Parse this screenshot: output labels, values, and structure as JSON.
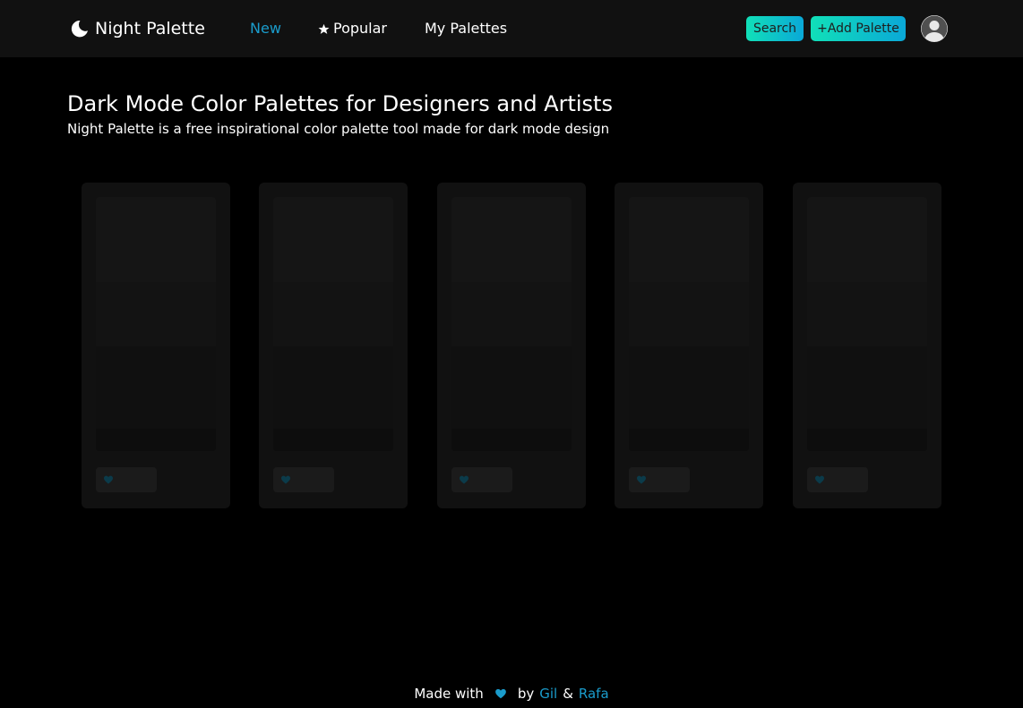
{
  "brand": {
    "name": "Night Palette",
    "icon": "moon-icon"
  },
  "nav": {
    "new": "New",
    "popular": "Popular",
    "my_palettes": "My Palettes"
  },
  "actions": {
    "search": "Search",
    "add_palette": "+Add Palette"
  },
  "hero": {
    "title": "Dark Mode Color Palettes for Designers and Artists",
    "subtitle": "Night Palette is a free inspirational color palette tool made for dark mode design"
  },
  "palettes": [
    {
      "colors": [
        "#151515",
        "#131313",
        "#101010",
        "#0d0d0d"
      ],
      "like_icon": "heart-icon"
    },
    {
      "colors": [
        "#151515",
        "#131313",
        "#101010",
        "#0d0d0d"
      ],
      "like_icon": "heart-icon"
    },
    {
      "colors": [
        "#151515",
        "#131313",
        "#101010",
        "#0d0d0d"
      ],
      "like_icon": "heart-icon"
    },
    {
      "colors": [
        "#151515",
        "#131313",
        "#101010",
        "#0d0d0d"
      ],
      "like_icon": "heart-icon"
    },
    {
      "colors": [
        "#151515",
        "#131313",
        "#101010",
        "#0d0d0d"
      ],
      "like_icon": "heart-icon"
    }
  ],
  "footer": {
    "made_with": "Made with",
    "by": "by",
    "author1": "Gil",
    "amp": "&",
    "author2": "Rafa"
  },
  "colors": {
    "accent": "#1a9ccc",
    "button_gradient_start": "#11e0b8",
    "button_gradient_end": "#0aa8d8",
    "navbar_bg": "#111111",
    "page_bg": "#000000",
    "card_bg": "#111111"
  }
}
